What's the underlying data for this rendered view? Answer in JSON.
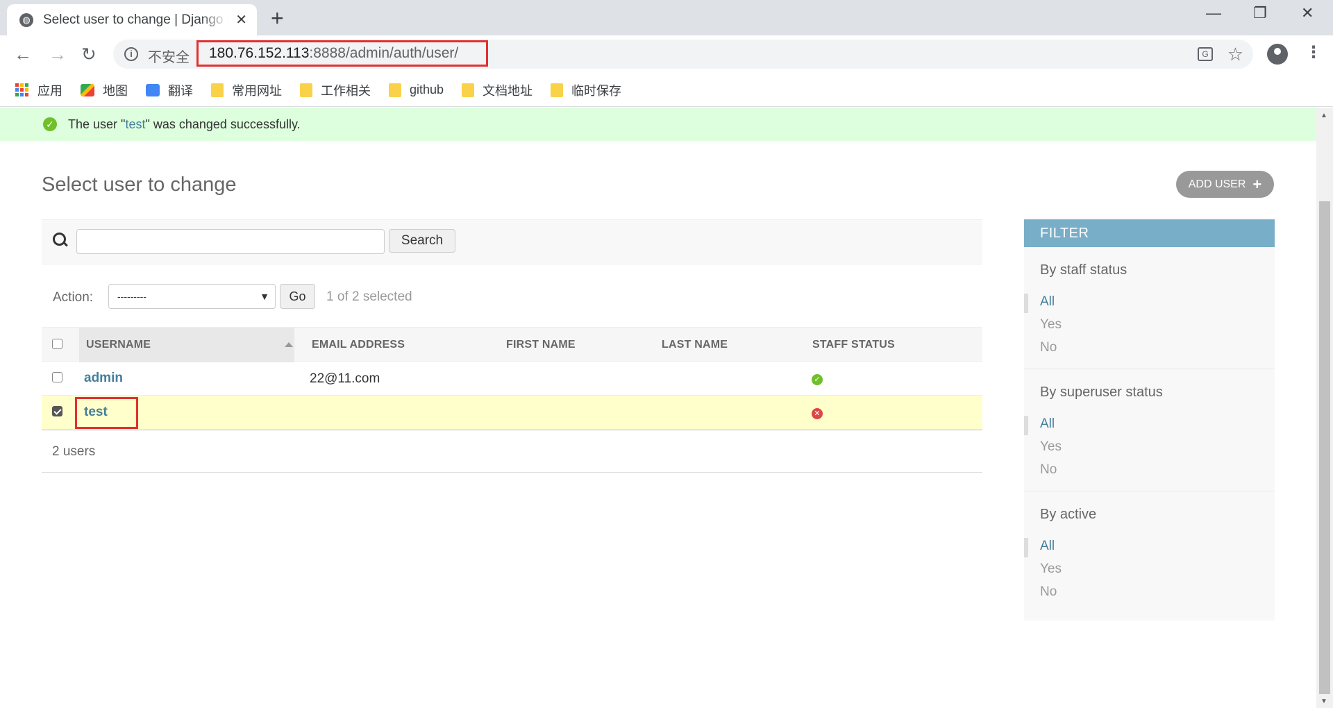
{
  "browser": {
    "tab_title": "Select user to change | Django site admin",
    "tab_close": "✕",
    "new_tab": "+",
    "window_controls": {
      "minimize": "—",
      "maximize": "❐",
      "close": "✕"
    },
    "nav": {
      "back": "←",
      "forward": "→",
      "reload": "↻"
    },
    "security_label": "不安全",
    "url_host": "180.76.152.113",
    "url_rest": ":8888/admin/auth/user/",
    "bookmarks": [
      {
        "label": "应用",
        "icon": "apps-icon"
      },
      {
        "label": "地图",
        "icon": "maps-icon"
      },
      {
        "label": "翻译",
        "icon": "translate-icon"
      },
      {
        "label": "常用网址",
        "icon": "folder-icon"
      },
      {
        "label": "工作相关",
        "icon": "folder-icon"
      },
      {
        "label": "github",
        "icon": "folder-icon"
      },
      {
        "label": "文档地址",
        "icon": "folder-icon"
      },
      {
        "label": "临时保存",
        "icon": "folder-icon"
      }
    ]
  },
  "message": {
    "prefix": "The user \"",
    "username": "test",
    "suffix": "\" was changed successfully."
  },
  "page": {
    "title": "Select user to change",
    "add_button": "ADD USER"
  },
  "search": {
    "value": "",
    "button": "Search"
  },
  "actions": {
    "label": "Action:",
    "selected_option": "---------",
    "go": "Go",
    "selection_count": "1 of 2 selected"
  },
  "table": {
    "columns": [
      "USERNAME",
      "EMAIL ADDRESS",
      "FIRST NAME",
      "LAST NAME",
      "STAFF STATUS"
    ],
    "rows": [
      {
        "username": "admin",
        "email": "22@11.com",
        "first_name": "",
        "last_name": "",
        "staff_status": true,
        "checked": false
      },
      {
        "username": "test",
        "email": "",
        "first_name": "",
        "last_name": "",
        "staff_status": false,
        "checked": true
      }
    ],
    "footer": "2 users"
  },
  "filter": {
    "title": "FILTER",
    "groups": [
      {
        "title": "By staff status",
        "options": [
          "All",
          "Yes",
          "No"
        ]
      },
      {
        "title": "By superuser status",
        "options": [
          "All",
          "Yes",
          "No"
        ]
      },
      {
        "title": "By active",
        "options": [
          "All",
          "Yes",
          "No"
        ]
      }
    ]
  },
  "colors": {
    "link": "#447e9b",
    "filter_header": "#79aec8",
    "success_bg": "#ddffdd",
    "selected_row": "#ffffcc",
    "highlight_box": "#e03131"
  }
}
